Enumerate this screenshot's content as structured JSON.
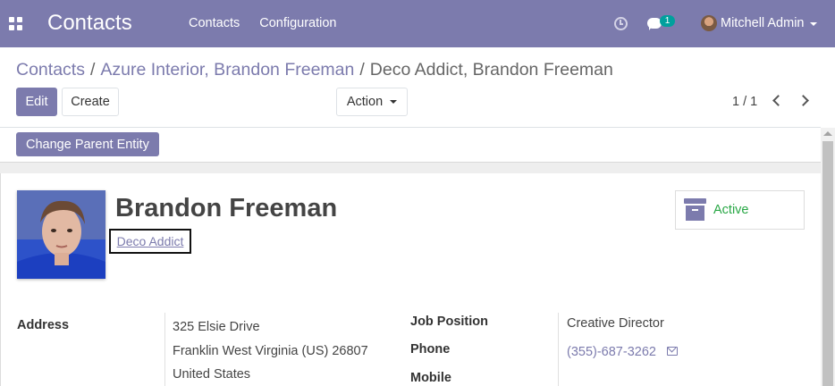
{
  "navbar": {
    "brand": "Contacts",
    "menu": [
      "Contacts",
      "Configuration"
    ],
    "chat_count": "1",
    "user_name": "Mitchell Admin",
    "background_color": "#7c7bad"
  },
  "breadcrumb": {
    "items": [
      "Contacts",
      "Azure Interior, Brandon Freeman"
    ],
    "current": "Deco Addict, Brandon Freeman"
  },
  "toolbar": {
    "edit_label": "Edit",
    "create_label": "Create",
    "action_label": "Action",
    "pager": "1 / 1"
  },
  "statusbar": {
    "change_parent_label": "Change Parent Entity"
  },
  "form": {
    "name": "Brandon Freeman",
    "company": "Deco Addict",
    "status_button": "Active",
    "labels": {
      "address": "Address",
      "job_position": "Job Position",
      "phone": "Phone",
      "mobile": "Mobile"
    },
    "address_lines": [
      "325 Elsie Drive",
      "Franklin West Virginia (US) 26807",
      "United States"
    ],
    "job_position": "Creative Director",
    "phone": "(355)-687-3262"
  },
  "colors": {
    "accent": "#7c7bad",
    "active": "#28a745",
    "badge": "#00a09d"
  }
}
